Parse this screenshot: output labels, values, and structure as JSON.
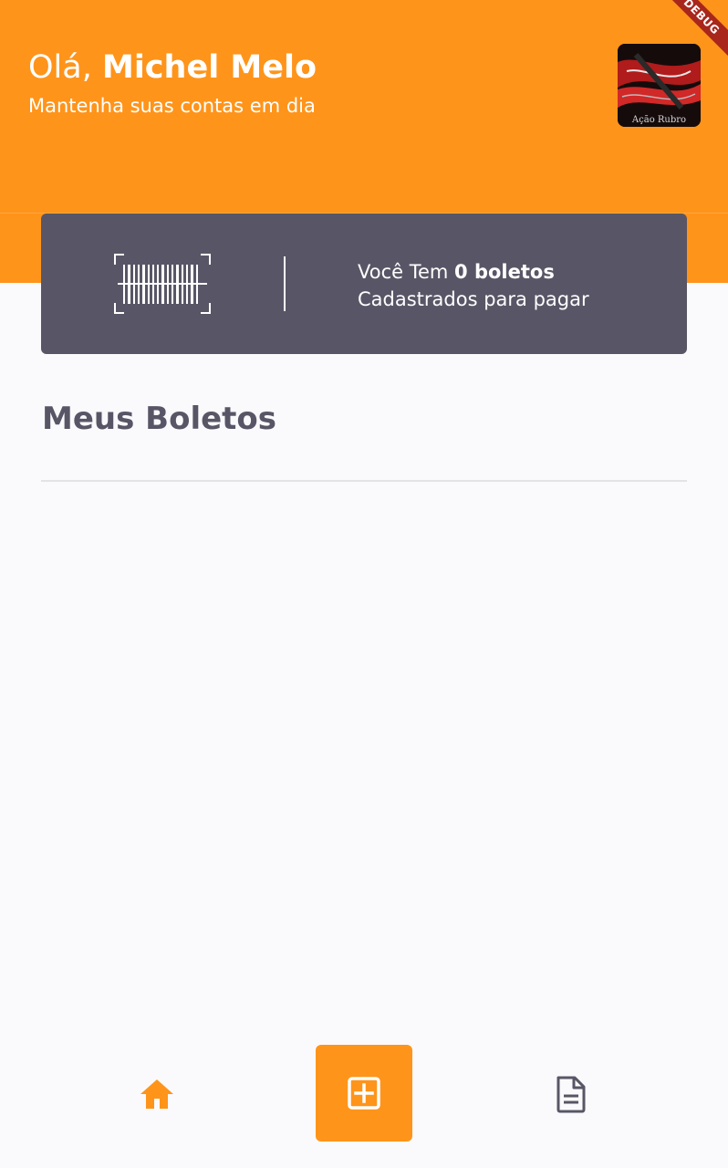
{
  "header": {
    "greeting_prefix": "Olá, ",
    "user_name": "Michel Melo",
    "subtitle": "Mantenha suas contas em dia",
    "avatar_caption": "Ação Rubro",
    "debug_banner": "DEBUG"
  },
  "summary_card": {
    "icon": "barcode-scan-icon",
    "text_prefix": "Você Tem ",
    "count_label": "0 boletos",
    "text_line2": "Cadastrados para pagar"
  },
  "section": {
    "title": "Meus Boletos"
  },
  "bottom_nav": {
    "home_icon": "home-icon",
    "add_icon": "add-box-icon",
    "docs_icon": "document-icon"
  },
  "colors": {
    "primary": "#FF941A",
    "card": "#585666",
    "background": "#FAFAFC",
    "divider": "#E3E3E6",
    "heading": "#585666"
  }
}
